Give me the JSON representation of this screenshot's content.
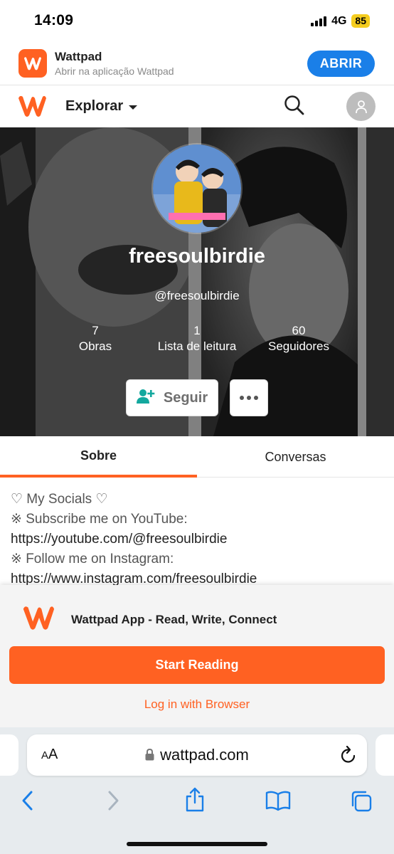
{
  "status_bar": {
    "time": "14:09",
    "network": "4G",
    "battery": "85",
    "colors": {
      "battery": "#f5cd1f"
    }
  },
  "app_banner": {
    "title": "Wattpad",
    "subtitle": "Abrir na aplicação Wattpad",
    "open_label": "ABRIR",
    "icon": "wattpad-logo-icon",
    "colors": {
      "open_button": "#1a7fe8"
    }
  },
  "header": {
    "explore_label": "Explorar",
    "icons": [
      "wattpad-logo-icon",
      "chevron-down-icon",
      "search-icon",
      "user-icon"
    ],
    "colors": {
      "brand": "#ff6122"
    }
  },
  "profile": {
    "username": "freesoulbirdie",
    "handle": "@freesoulbirdie",
    "stats": [
      {
        "value": "7",
        "label": "Obras"
      },
      {
        "value": "1",
        "label": "Lista de leitura"
      },
      {
        "value": "60",
        "label": "Seguidores"
      }
    ],
    "follow_label": "Seguir",
    "icons": [
      "add-user-icon",
      "more-icon"
    ]
  },
  "tabs": [
    {
      "label": "Sobre",
      "active": true
    },
    {
      "label": "Conversas",
      "active": false
    }
  ],
  "about": {
    "lines": [
      "♡ My Socials ♡",
      "※ Subscribe me on YouTube:",
      "https://youtube.com/@freesoulbirdie",
      "※ Follow me on Instagram:",
      "https://www.instagram.com/freesoulbirdie"
    ]
  },
  "app_sheet": {
    "title": "Wattpad App - Read, Write, Connect",
    "start_label": "Start Reading",
    "login_label": "Log in with Browser",
    "colors": {
      "primary": "#ff6122"
    }
  },
  "browser": {
    "text_size_label": "AA",
    "url": "wattpad.com",
    "icons": [
      "lock-icon",
      "reload-icon",
      "back-icon",
      "forward-icon",
      "share-icon",
      "bookmarks-icon",
      "tabs-icon"
    ]
  }
}
